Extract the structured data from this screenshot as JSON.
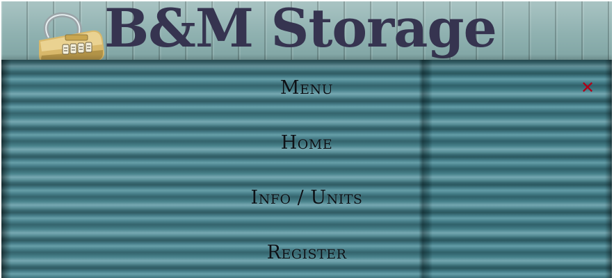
{
  "header": {
    "site_title": "B&M Storage",
    "logo_icon": "padlock-icon"
  },
  "menu": {
    "heading": "Menu",
    "close_icon": "close-icon",
    "close_symbol": "✕",
    "items": [
      {
        "label": "Home"
      },
      {
        "label": "Info / Units"
      },
      {
        "label": "Register"
      }
    ]
  },
  "colors": {
    "title": "#363450",
    "close": "#b00018",
    "door": "#3f7c86",
    "siding": "#8fb1b0"
  }
}
